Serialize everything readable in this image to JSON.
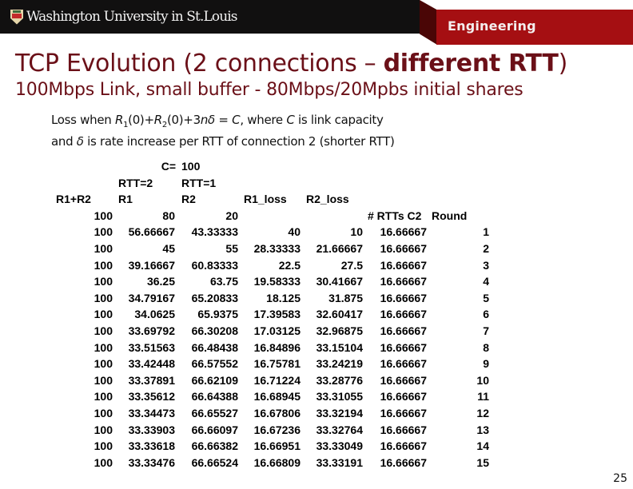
{
  "header": {
    "university_wordmark": "Washington University in St.Louis",
    "logo_icon": "university-shield-icon",
    "school_label": "Engineering",
    "colors": {
      "band_black": "#111010",
      "band_red": "#a50f12",
      "fold_dark_red": "#4a0606"
    }
  },
  "slide": {
    "title_plain": "TCP Evolution (2 connections – ",
    "title_bold": "different RTT",
    "title_end": ")",
    "subtitle": "100Mbps Link, small buffer - 80Mbps/20Mpbs initial shares",
    "title_color": "#6b1018",
    "body": {
      "line1": {
        "t1": "Loss when ",
        "r1": "R",
        "sub1": "1",
        "t2": "(0)+",
        "r2": "R",
        "sub2": "2",
        "t3": "(0)+3",
        "n": "n",
        "delta": "δ",
        "t4": " = ",
        "c": "C",
        "t5": ", where ",
        "c2": "C",
        "t6": " is link capacity"
      },
      "line2": {
        "t1": "and ",
        "delta": "δ",
        "t2": " is rate increase per RTT of connection 2 (shorter RTT)"
      }
    },
    "page_number": "25"
  },
  "table": {
    "capacity_label": "C=",
    "capacity_value": "100",
    "rtt1_label": "RTT=2",
    "rtt2_label": "RTT=1",
    "headers": [
      "R1+R2",
      "R1",
      "R2",
      "R1_loss",
      "R2_loss"
    ],
    "extra_headers": [
      "# RTTs C2",
      "Round"
    ],
    "initial_row": [
      "100",
      "80",
      "20"
    ],
    "rows": [
      [
        "100",
        "56.66667",
        "43.33333",
        "40",
        "10",
        "16.66667",
        "1"
      ],
      [
        "100",
        "45",
        "55",
        "28.33333",
        "21.66667",
        "16.66667",
        "2"
      ],
      [
        "100",
        "39.16667",
        "60.83333",
        "22.5",
        "27.5",
        "16.66667",
        "3"
      ],
      [
        "100",
        "36.25",
        "63.75",
        "19.58333",
        "30.41667",
        "16.66667",
        "4"
      ],
      [
        "100",
        "34.79167",
        "65.20833",
        "18.125",
        "31.875",
        "16.66667",
        "5"
      ],
      [
        "100",
        "34.0625",
        "65.9375",
        "17.39583",
        "32.60417",
        "16.66667",
        "6"
      ],
      [
        "100",
        "33.69792",
        "66.30208",
        "17.03125",
        "32.96875",
        "16.66667",
        "7"
      ],
      [
        "100",
        "33.51563",
        "66.48438",
        "16.84896",
        "33.15104",
        "16.66667",
        "8"
      ],
      [
        "100",
        "33.42448",
        "66.57552",
        "16.75781",
        "33.24219",
        "16.66667",
        "9"
      ],
      [
        "100",
        "33.37891",
        "66.62109",
        "16.71224",
        "33.28776",
        "16.66667",
        "10"
      ],
      [
        "100",
        "33.35612",
        "66.64388",
        "16.68945",
        "33.31055",
        "16.66667",
        "11"
      ],
      [
        "100",
        "33.34473",
        "66.65527",
        "16.67806",
        "33.32194",
        "16.66667",
        "12"
      ],
      [
        "100",
        "33.33903",
        "66.66097",
        "16.67236",
        "33.32764",
        "16.66667",
        "13"
      ],
      [
        "100",
        "33.33618",
        "66.66382",
        "16.66951",
        "33.33049",
        "16.66667",
        "14"
      ],
      [
        "100",
        "33.33476",
        "66.66524",
        "16.66809",
        "33.33191",
        "16.66667",
        "15"
      ]
    ]
  }
}
